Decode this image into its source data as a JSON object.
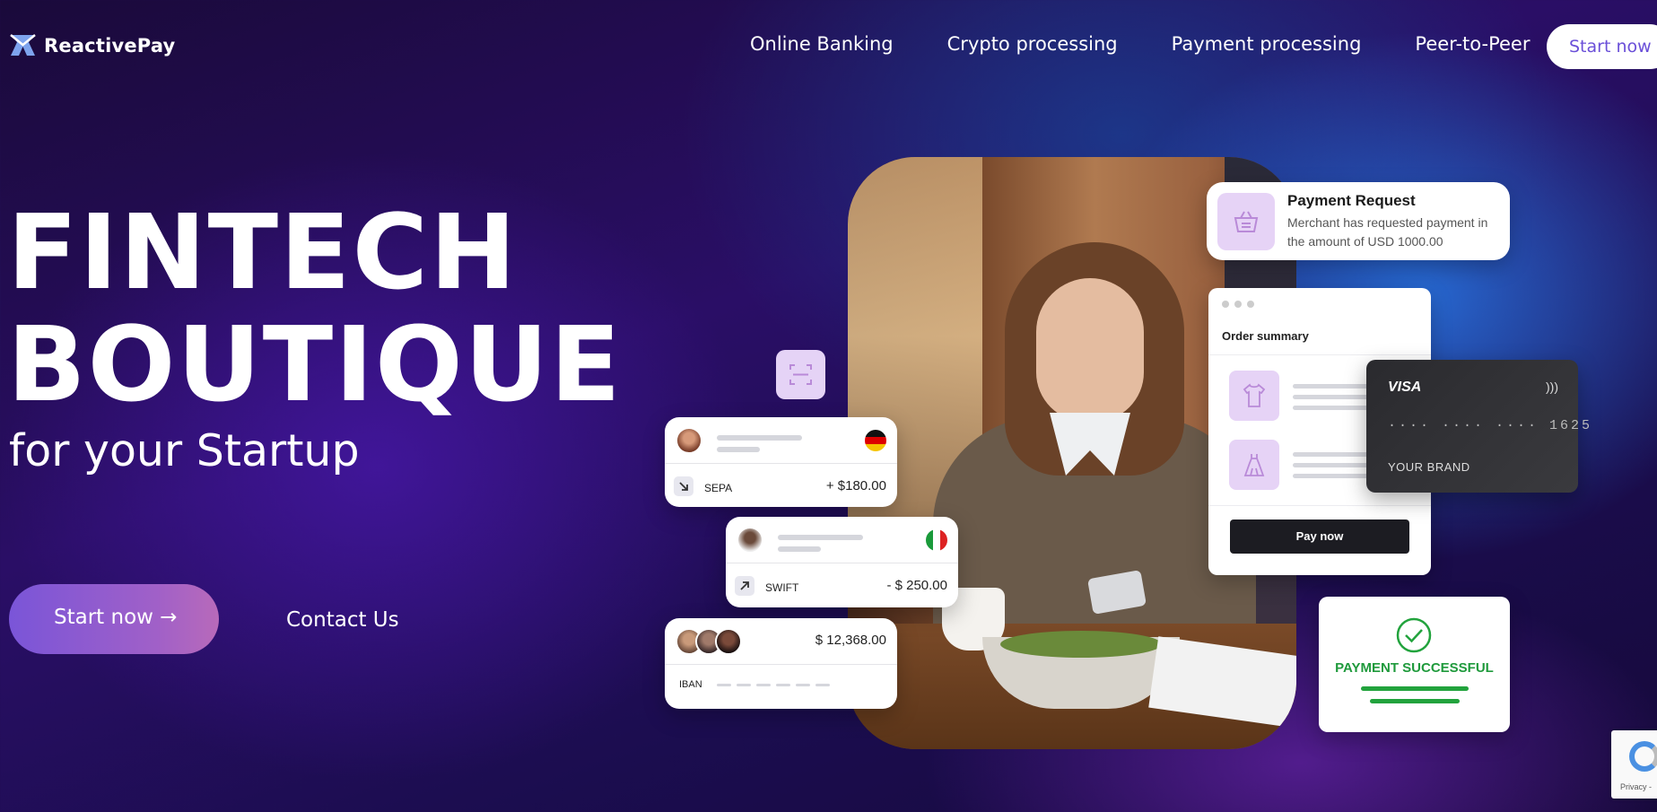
{
  "brand": {
    "name": "ReactivePay",
    "logo_icon": "reactivepay-logo-icon"
  },
  "nav": {
    "items": [
      {
        "label": "Online Banking"
      },
      {
        "label": "Crypto processing"
      },
      {
        "label": "Payment processing"
      },
      {
        "label": "Peer-to-Peer"
      }
    ],
    "cta_label": "Start now"
  },
  "hero": {
    "title_line1": "FINTECH",
    "title_line2": "BOUTIQUE",
    "subtitle": "for your Startup",
    "primary_button": "Start now →",
    "secondary_button": "Contact Us"
  },
  "payment_request": {
    "title": "Payment Request",
    "description": "Merchant has requested payment in the amount of USD 1000.00",
    "icon": "basket-icon"
  },
  "transactions": [
    {
      "method": "SEPA",
      "amount": "+ $180.00",
      "flag": "germany-flag",
      "direction": "incoming"
    },
    {
      "method": "SWIFT",
      "amount": "- $ 250.00",
      "flag": "italy-flag",
      "direction": "outgoing"
    }
  ],
  "iban_card": {
    "amount": "$ 12,368.00",
    "label": "IBAN"
  },
  "order_summary": {
    "title": "Order summary",
    "items": [
      {
        "icon": "shirt-icon"
      },
      {
        "icon": "dress-icon"
      }
    ],
    "pay_button": "Pay now"
  },
  "visa_card": {
    "brand": "VISA",
    "number": "····  ····  ····  1625",
    "holder": "YOUR BRAND"
  },
  "payment_status": {
    "label": "PAYMENT SUCCESSFUL",
    "color": "#1f9a3c"
  },
  "recaptcha": {
    "text": "Privacy -"
  },
  "colors": {
    "accent": "#6a4fd8",
    "button_gradient_start": "#7a55d8",
    "button_gradient_end": "#b86aba",
    "success": "#22a33d",
    "card_lavender": "#e6d3f6"
  }
}
